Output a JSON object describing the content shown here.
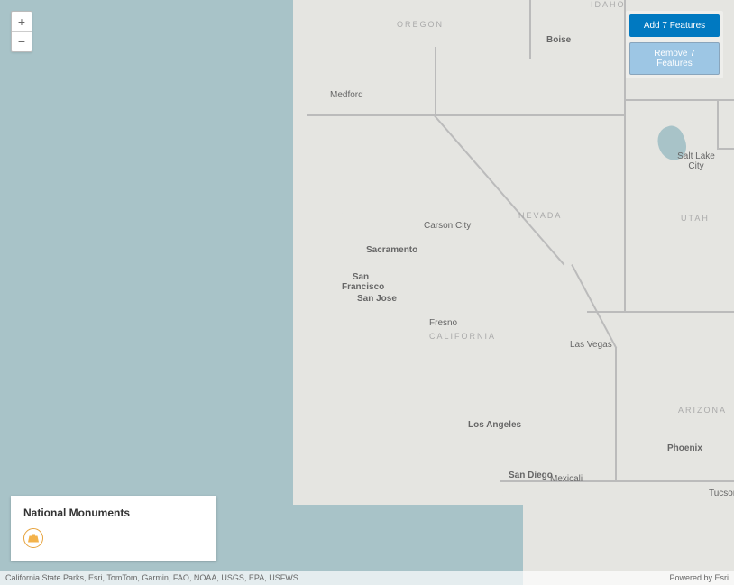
{
  "zoom": {
    "in_label": "+",
    "out_label": "−"
  },
  "actions": {
    "add_label": "Add 7 Features",
    "remove_label": "Remove 7 Features"
  },
  "legend": {
    "title": "National Monuments"
  },
  "attribution": {
    "left": "California State Parks, Esri, TomTom, Garmin, FAO, NOAA, USGS, EPA, USFWS",
    "right": "Powered by Esri"
  },
  "labels": {
    "oregon": "OREGON",
    "idaho": "IDAHO",
    "nevada": "NEVADA",
    "california": "CALIFORNIA",
    "arizona": "ARIZONA",
    "utah": "UTAH",
    "boise": "Boise",
    "medford": "Medford",
    "slc": "Salt Lake City",
    "carson": "Carson City",
    "sacramento": "Sacramento",
    "sf": "San Francisco",
    "sj": "San Jose",
    "fresno": "Fresno",
    "vegas": "Las Vegas",
    "la": "Los Angeles",
    "sd": "San Diego",
    "mexicali": "Mexicali",
    "phoenix": "Phoenix",
    "tucson": "Tucson"
  }
}
